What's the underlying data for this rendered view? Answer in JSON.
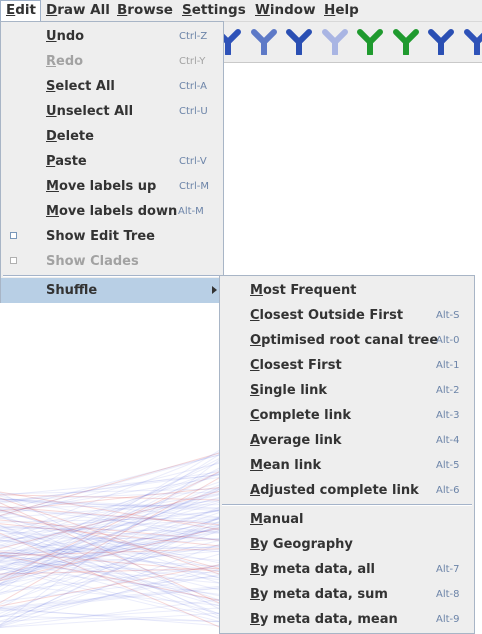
{
  "menubar": {
    "items": [
      {
        "mnemonic": "E",
        "rest": "dit"
      },
      {
        "mnemonic": "D",
        "rest": "raw All"
      },
      {
        "mnemonic": "B",
        "rest": "rowse"
      },
      {
        "mnemonic": "S",
        "rest": "ettings"
      },
      {
        "mnemonic": "W",
        "rest": "indow"
      },
      {
        "mnemonic": "H",
        "rest": "elp"
      }
    ]
  },
  "toolbar": {
    "icons": [
      {
        "name": "tree-style-icon",
        "color": "#2e52b8"
      },
      {
        "name": "tree-style-icon",
        "color": "#5d79c7"
      },
      {
        "name": "tree-style-icon",
        "color": "#2a4fb3"
      },
      {
        "name": "tree-style-icon",
        "color": "#a9b5e3"
      },
      {
        "name": "tree-style-icon",
        "color": "#1f9a2e"
      },
      {
        "name": "tree-style-icon",
        "color": "#1f9a2e"
      },
      {
        "name": "tree-style-icon",
        "color": "#2a4fb3"
      },
      {
        "name": "tree-style-icon",
        "color": "#2e52b8"
      }
    ]
  },
  "edit_menu": {
    "undo": {
      "mnemonic": "U",
      "rest": "ndo",
      "accel": "Ctrl-Z"
    },
    "redo": {
      "mnemonic": "R",
      "rest": "edo",
      "accel": "Ctrl-Y"
    },
    "select_all": {
      "mnemonic": "S",
      "rest": "elect All",
      "accel": "Ctrl-A"
    },
    "unselect_all": {
      "mnemonic": "U",
      "rest": "nselect All",
      "accel": "Ctrl-U"
    },
    "delete": {
      "mnemonic": "D",
      "rest": "elete"
    },
    "paste": {
      "mnemonic": "P",
      "rest": "aste",
      "accel": "Ctrl-V"
    },
    "move_up": {
      "mnemonic": "M",
      "rest": "ove labels up",
      "accel": "Ctrl-M"
    },
    "move_down": {
      "mnemonic": "M",
      "rest": "ove labels down",
      "accel": "Alt-M"
    },
    "show_edit_tree": {
      "label": "Show Edit Tree"
    },
    "show_clades": {
      "label": "Show Clades"
    },
    "shuffle": {
      "label": "Shuffle"
    }
  },
  "shuffle_menu": {
    "most_frequent": {
      "mnemonic": "M",
      "rest": "ost Frequent"
    },
    "closest_outside_first": {
      "mnemonic": "C",
      "rest": "losest Outside First",
      "accel": "Alt-S"
    },
    "optimised_root_canal_tree": {
      "mnemonic": "O",
      "rest": "ptimised root canal tree",
      "accel": "Alt-0"
    },
    "closest_first": {
      "mnemonic": "C",
      "rest": "losest First",
      "accel": "Alt-1"
    },
    "single_link": {
      "mnemonic": "S",
      "rest": "ingle link",
      "accel": "Alt-2"
    },
    "complete_link": {
      "mnemonic": "C",
      "rest": "omplete link",
      "accel": "Alt-3"
    },
    "average_link": {
      "mnemonic": "A",
      "rest": "verage link",
      "accel": "Alt-4"
    },
    "mean_link": {
      "mnemonic": "M",
      "rest": "ean link",
      "accel": "Alt-5"
    },
    "adjusted_complete_link": {
      "mnemonic": "A",
      "rest": "djusted complete link",
      "accel": "Alt-6"
    },
    "manual": {
      "mnemonic": "M",
      "rest": "anual"
    },
    "by_geography": {
      "mnemonic": "B",
      "rest": "y Geography"
    },
    "by_meta_all": {
      "mnemonic": "B",
      "rest": "y meta data, all",
      "accel": "Alt-7"
    },
    "by_meta_sum": {
      "mnemonic": "B",
      "rest": "y meta data, sum",
      "accel": "Alt-8"
    },
    "by_meta_mean": {
      "mnemonic": "B",
      "rest": "y meta data, mean",
      "accel": "Alt-9"
    }
  }
}
